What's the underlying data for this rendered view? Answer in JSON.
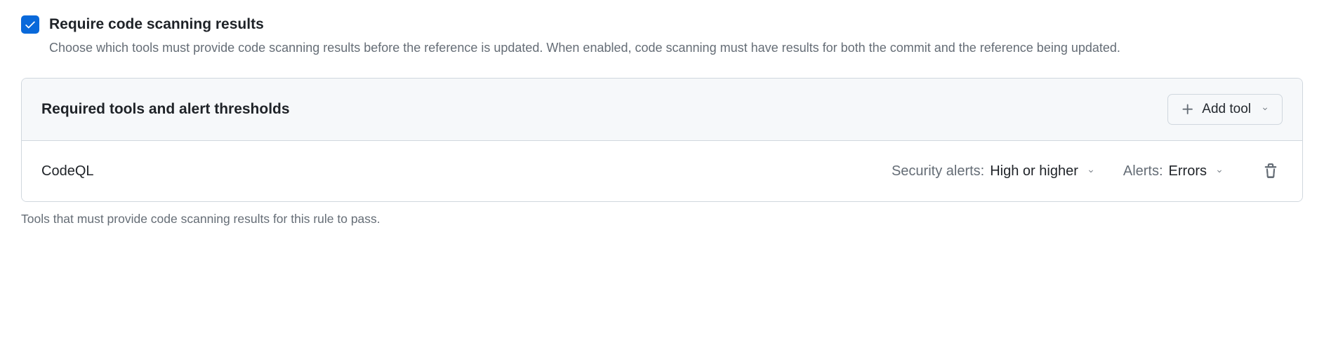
{
  "header": {
    "title": "Require code scanning results",
    "description": "Choose which tools must provide code scanning results before the reference is updated. When enabled, code scanning must have results for both the commit and the reference being updated."
  },
  "panel": {
    "title": "Required tools and alert thresholds",
    "add_button_label": "Add tool",
    "rows": [
      {
        "tool_name": "CodeQL",
        "security_alerts_label": "Security alerts:",
        "security_alerts_value": "High or higher",
        "alerts_label": "Alerts:",
        "alerts_value": "Errors"
      }
    ]
  },
  "footer_note": "Tools that must provide code scanning results for this rule to pass."
}
